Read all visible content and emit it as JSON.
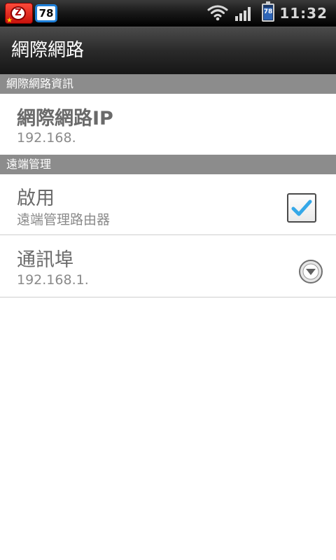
{
  "status_bar": {
    "notification_badge": "78",
    "battery_level": "78",
    "time": "11:32"
  },
  "title_bar": {
    "title": "網際網路"
  },
  "sections": [
    {
      "header": "網際網路資訊",
      "items": [
        {
          "title": "網際網路IP",
          "summary": "192.168."
        }
      ]
    },
    {
      "header": "遠端管理",
      "items": [
        {
          "title": "啟用",
          "summary": "遠端管理路由器",
          "checked": true
        },
        {
          "title": "通訊埠",
          "summary": "192.168.1."
        }
      ]
    }
  ],
  "colors": {
    "section_header_bg": "#8c8c8c",
    "checkmark": "#35a8e8",
    "title_bar_bg": "#2a2a2a"
  }
}
